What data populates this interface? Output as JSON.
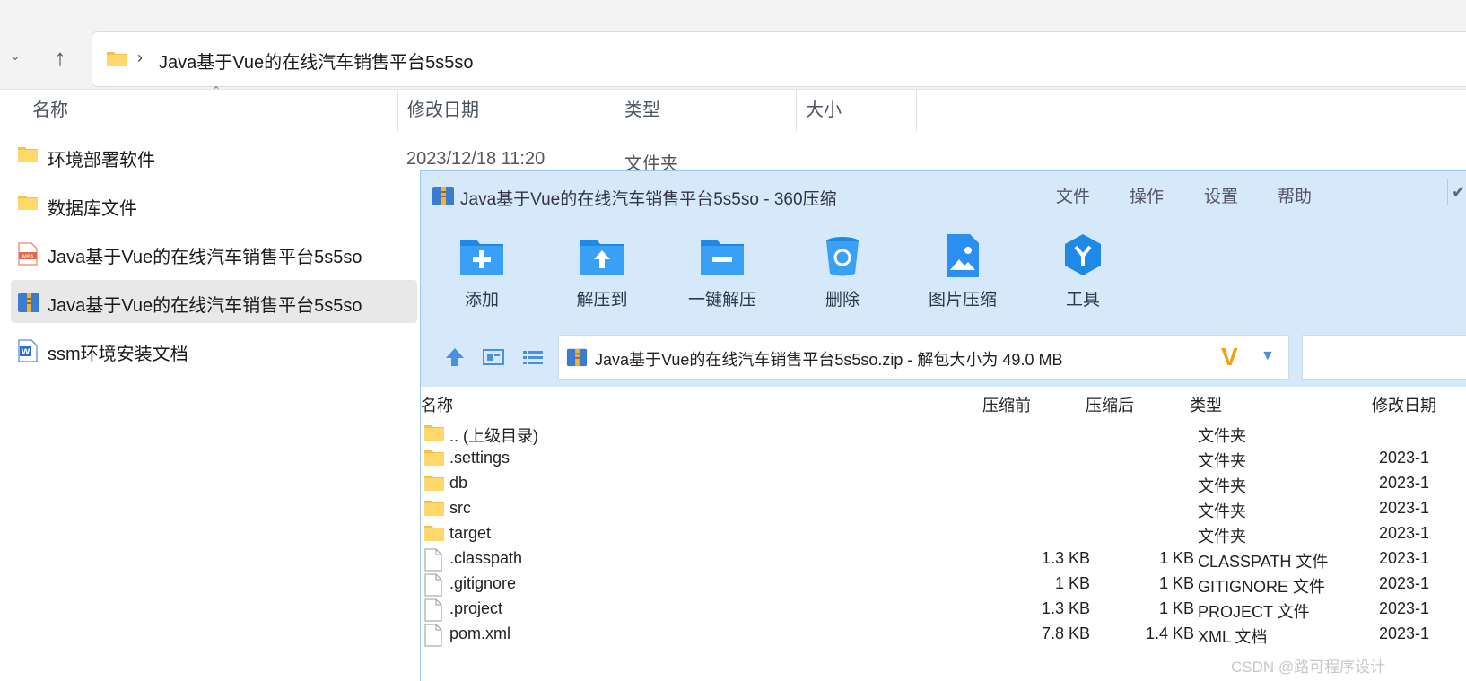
{
  "explorer": {
    "address_path": "Java基于Vue的在线汽车销售平台5s5so",
    "columns": [
      "名称",
      "修改日期",
      "类型",
      "大小"
    ],
    "first_row_date": "2023/12/18 11:20",
    "first_row_type": "文件夹",
    "items": [
      {
        "label": "环境部署软件",
        "icon": "folder-icon"
      },
      {
        "label": "数据库文件",
        "icon": "folder-icon"
      },
      {
        "label": "Java基于Vue的在线汽车销售平台5s5so",
        "icon": "mp4-file-icon"
      },
      {
        "label": "Java基于Vue的在线汽车销售平台5s5so",
        "icon": "zip-archive-icon"
      },
      {
        "label": "ssm环境安装文档",
        "icon": "word-doc-icon"
      }
    ]
  },
  "zipwin": {
    "title": "Java基于Vue的在线汽车销售平台5s5so - 360压缩",
    "menu": [
      "文件",
      "操作",
      "设置",
      "帮助"
    ],
    "tools": [
      "添加",
      "解压到",
      "一键解压",
      "删除",
      "图片压缩",
      "工具"
    ],
    "path_text": "Java基于Vue的在线汽车销售平台5s5so.zip - 解包大小为 49.0 MB",
    "columns": [
      "名称",
      "压缩前",
      "压缩后",
      "类型",
      "修改日期"
    ],
    "rows": [
      {
        "name": ".. (上级目录)",
        "before": "",
        "after": "",
        "type": "文件夹",
        "date": ""
      },
      {
        "name": ".settings",
        "before": "",
        "after": "",
        "type": "文件夹",
        "date": "2023-1"
      },
      {
        "name": "db",
        "before": "",
        "after": "",
        "type": "文件夹",
        "date": "2023-1"
      },
      {
        "name": "src",
        "before": "",
        "after": "",
        "type": "文件夹",
        "date": "2023-1"
      },
      {
        "name": "target",
        "before": "",
        "after": "",
        "type": "文件夹",
        "date": "2023-1"
      },
      {
        "name": ".classpath",
        "before": "1.3 KB",
        "after": "1 KB",
        "type": "CLASSPATH 文件",
        "date": "2023-1"
      },
      {
        "name": ".gitignore",
        "before": "1 KB",
        "after": "1 KB",
        "type": "GITIGNORE 文件",
        "date": "2023-1"
      },
      {
        "name": ".project",
        "before": "1.3 KB",
        "after": "1 KB",
        "type": "PROJECT 文件",
        "date": "2023-1"
      },
      {
        "name": "pom.xml",
        "before": "7.8 KB",
        "after": "1.4 KB",
        "type": "XML 文档",
        "date": "2023-1"
      }
    ]
  },
  "watermark": "CSDN @路可程序设计"
}
